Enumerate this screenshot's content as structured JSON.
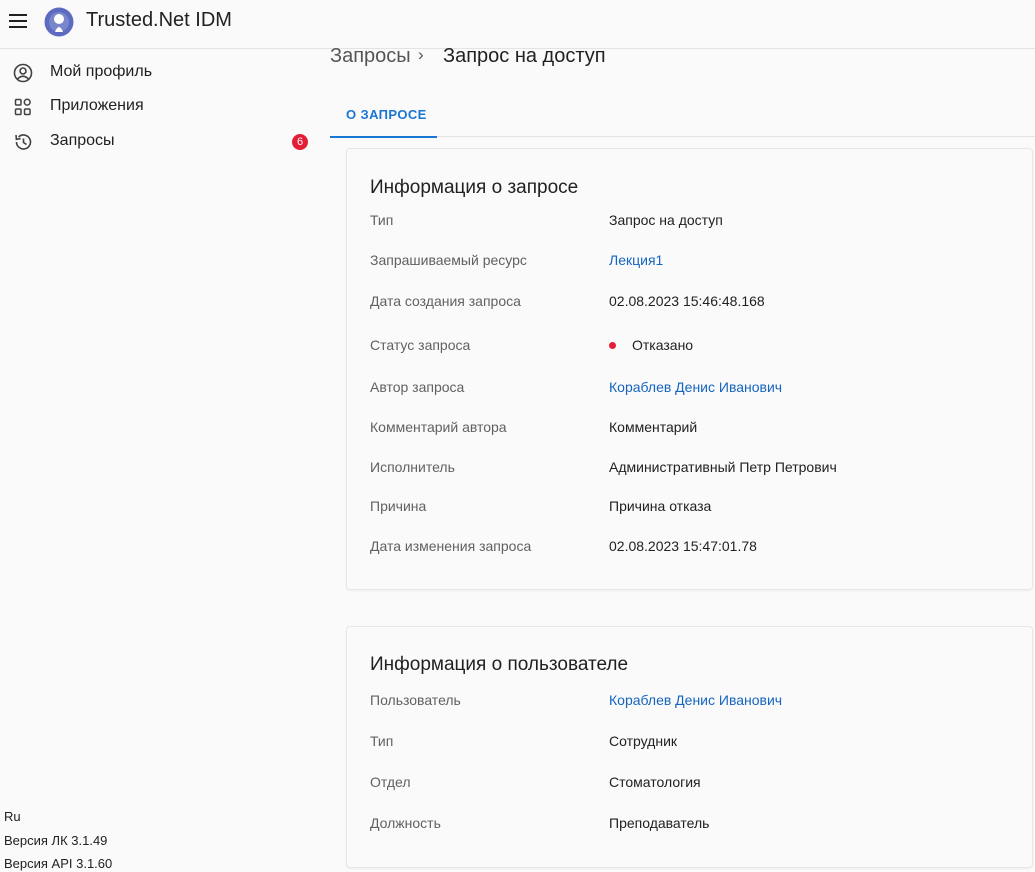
{
  "app": {
    "title": "Trusted.Net IDM",
    "logo": "keyhole-logo"
  },
  "sidebar": {
    "items": [
      {
        "label": "Мой профиль",
        "icon": "user-circle-icon"
      },
      {
        "label": "Приложения",
        "icon": "apps-grid-icon"
      },
      {
        "label": "Запросы",
        "icon": "history-icon",
        "badge": "6"
      }
    ]
  },
  "footer": {
    "language": "Ru",
    "lk_version": "Версия ЛК 3.1.49",
    "api_version": "Версия API 3.1.60"
  },
  "breadcrumb": {
    "parent": "Запросы",
    "current": "Запрос на доступ"
  },
  "tabs": [
    {
      "label": "О ЗАПРОСЕ",
      "active": true
    }
  ],
  "request_card": {
    "title": "Информация о запросе",
    "rows": [
      {
        "label": "Тип",
        "value": "Запрос на доступ"
      },
      {
        "label": "Запрашиваемый ресурс",
        "value": "Лекция1"
      },
      {
        "label": "Дата создания запроса",
        "value": "02.08.2023 15:46:48.168"
      },
      {
        "label": "Статус запроса",
        "value": "Отказано"
      },
      {
        "label": "Автор запроса",
        "value": "Кораблев Денис Иванович"
      },
      {
        "label": "Комментарий автора",
        "value": "Комментарий"
      },
      {
        "label": "Исполнитель",
        "value": "Административный Петр Петрович"
      },
      {
        "label": "Причина",
        "value": "Причина отказа"
      },
      {
        "label": "Дата изменения запроса",
        "value": "02.08.2023 15:47:01.78"
      }
    ]
  },
  "user_card": {
    "title": "Информация о пользователе",
    "rows": [
      {
        "label": "Пользователь",
        "value": "Кораблев Денис Иванович"
      },
      {
        "label": "Тип",
        "value": "Сотрудник"
      },
      {
        "label": "Отдел",
        "value": "Стоматология"
      },
      {
        "label": "Должность",
        "value": "Преподаватель"
      }
    ]
  },
  "colors": {
    "accent": "#1976d2",
    "link": "#1565c0",
    "status_rejected": "#e31e35",
    "badge": "#e31e35"
  }
}
